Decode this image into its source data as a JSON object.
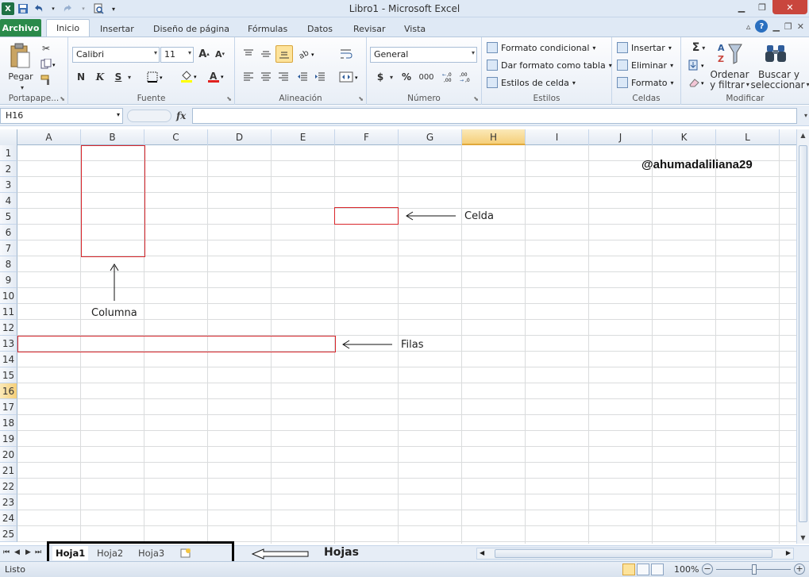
{
  "window": {
    "title": "Libro1  -  Microsoft Excel"
  },
  "qat": {
    "app_icon": "X",
    "save_icon": "save-icon",
    "undo_icon": "undo-icon",
    "redo_icon": "redo-icon",
    "print_icon": "print-preview-icon"
  },
  "ribbon_tabs": {
    "file": "Archivo",
    "tabs": [
      "Inicio",
      "Insertar",
      "Diseño de página",
      "Fórmulas",
      "Datos",
      "Revisar",
      "Vista"
    ]
  },
  "groups": {
    "clipboard": {
      "label": "Portapape...",
      "paste": "Pegar"
    },
    "font": {
      "label": "Fuente",
      "font_name": "Calibri",
      "font_size": "11",
      "bold": "N",
      "italic": "K",
      "underline": "S",
      "grow": "A",
      "shrink": "A",
      "font_color": "A"
    },
    "alignment": {
      "label": "Alineación"
    },
    "number": {
      "label": "Número",
      "format": "General",
      "currency": "$",
      "percent": "%",
      "thousands": "000"
    },
    "styles": {
      "label": "Estilos",
      "conditional": "Formato condicional",
      "as_table": "Dar formato como tabla",
      "cell_styles": "Estilos de celda"
    },
    "cells": {
      "label": "Celdas",
      "insert": "Insertar",
      "delete": "Eliminar",
      "format": "Formato"
    },
    "editing": {
      "label": "Modificar",
      "sigma": "Σ",
      "sort_1": "Ordenar",
      "sort_2": "y filtrar",
      "find_1": "Buscar y",
      "find_2": "seleccionar"
    }
  },
  "formula_bar": {
    "name_box": "H16",
    "fx": "fx",
    "value": ""
  },
  "grid": {
    "columns": [
      "A",
      "B",
      "C",
      "D",
      "E",
      "F",
      "G",
      "H",
      "I",
      "J",
      "K",
      "L"
    ],
    "rows": [
      "1",
      "2",
      "3",
      "4",
      "5",
      "6",
      "7",
      "8",
      "9",
      "10",
      "11",
      "12",
      "13",
      "14",
      "15",
      "16",
      "17",
      "18",
      "19",
      "20",
      "21",
      "22",
      "23",
      "24",
      "25"
    ]
  },
  "annotations": {
    "watermark": "@ahumadaliliana29",
    "celda": "Celda",
    "columna": "Columna",
    "filas": "Filas",
    "hojas": "Hojas"
  },
  "sheets": {
    "tabs": [
      "Hoja1",
      "Hoja2",
      "Hoja3"
    ],
    "active": "Hoja1"
  },
  "status": {
    "text": "Listo",
    "zoom": "100%"
  },
  "colors": {
    "accent_green": "#2a8a4a",
    "annotation_red": "#d9262b"
  }
}
